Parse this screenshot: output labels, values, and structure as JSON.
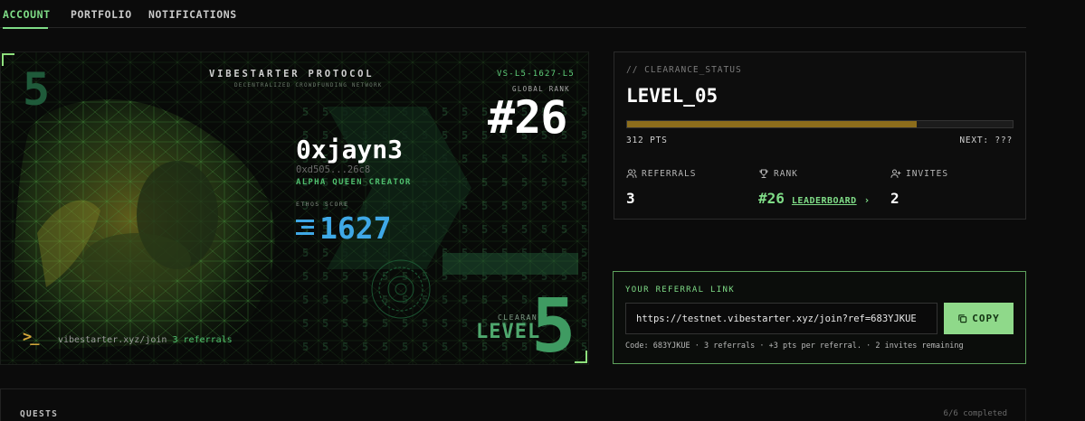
{
  "tabs": [
    {
      "label": "ACCOUNT",
      "active": true
    },
    {
      "label": "PORTFOLIO",
      "active": false
    },
    {
      "label": "NOTIFICATIONS",
      "active": false
    }
  ],
  "card": {
    "level_digit": "5",
    "protocol_title": "VIBESTARTER PROTOCOL",
    "protocol_subtitle": "DECENTRALIZED CROWDFUNDING NETWORK",
    "card_id": "VS-L5-1627-L5",
    "rank_label": "GLOBAL RANK",
    "rank": "#26",
    "handle": "0xjayn3",
    "address": "0xd505...26c8",
    "role": "ALPHA QUEEN CREATOR",
    "ethos_label": "ETHOS SCORE",
    "ethos_score": "1627",
    "clearance_label": "CLEARANCE",
    "level_word": "LEVEL",
    "level_big": "5",
    "prompt_symbol": ">_",
    "footer_link": "vibestarter.xyz/join",
    "footer_referrals": "3 referrals",
    "accent_color": "#7fdc87",
    "ethos_color": "#3fa8e6"
  },
  "clearance": {
    "label": "// CLEARANCE_STATUS",
    "level": "LEVEL_05",
    "progress_fraction": 0.75,
    "progress_color": "#8c6d1c",
    "points": "312 PTS",
    "next": "NEXT: ???",
    "stats": {
      "referrals": {
        "label": "REFERRALS",
        "value": "3",
        "icon": "users-icon"
      },
      "rank": {
        "label": "RANK",
        "value": "#26",
        "link": "LEADERBOARD",
        "icon": "trophy-icon"
      },
      "invites": {
        "label": "INVITES",
        "value": "2",
        "icon": "user-plus-icon"
      }
    }
  },
  "referral": {
    "title": "YOUR REFERRAL LINK",
    "link": "https://testnet.vibestarter.xyz/join?ref=683YJKUE",
    "copy_label": "COPY",
    "meta": "Code: 683YJKUE · 3 referrals · +3 pts per referral. · 2 invites remaining"
  },
  "quests": {
    "title": "QUESTS",
    "completed": "6/6 completed"
  }
}
